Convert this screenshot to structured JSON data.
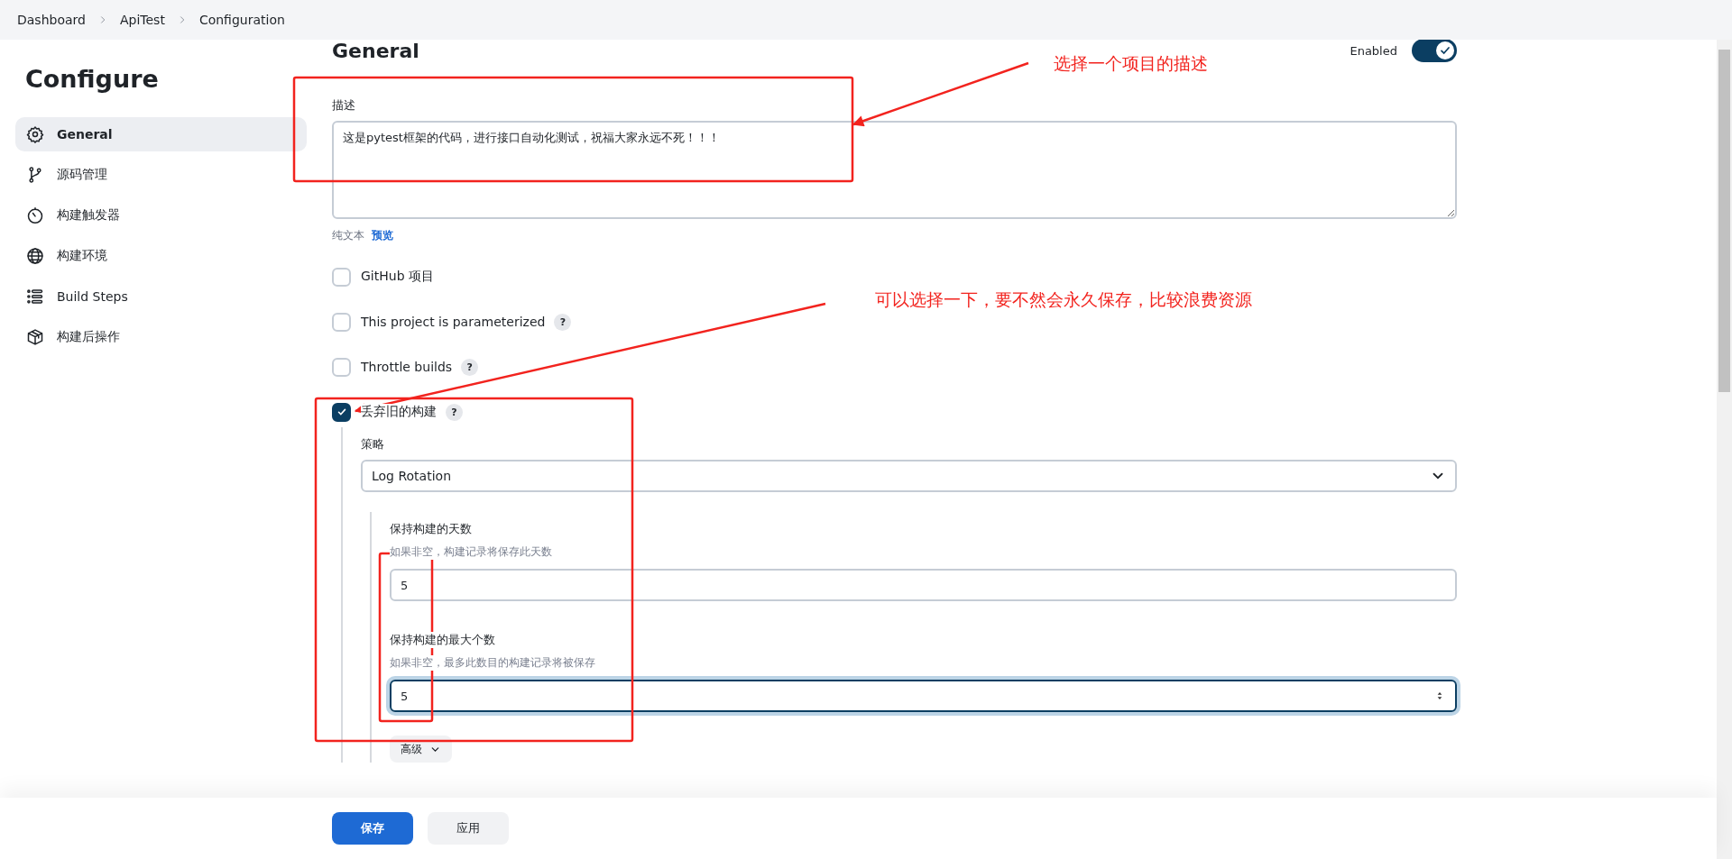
{
  "breadcrumbs": [
    "Dashboard",
    "ApiTest",
    "Configuration"
  ],
  "sidebar": {
    "title": "Configure",
    "items": [
      {
        "label": "General",
        "selected": true
      },
      {
        "label": "源码管理",
        "selected": false
      },
      {
        "label": "构建触发器",
        "selected": false
      },
      {
        "label": "构建环境",
        "selected": false
      },
      {
        "label": "Build Steps",
        "selected": false
      },
      {
        "label": "构建后操作",
        "selected": false
      }
    ]
  },
  "section": {
    "title": "General",
    "toggle": {
      "label": "Enabled",
      "on": true
    }
  },
  "description": {
    "label": "描述",
    "value": "这是pytest框架的代码，进行接口自动化测试，祝福大家永远不死！！！",
    "plain_text": "纯文本",
    "preview_link": "预览"
  },
  "options": [
    {
      "label": "GitHub 项目",
      "checked": false
    },
    {
      "label": "This project is parameterized",
      "checked": false,
      "help": "?"
    },
    {
      "label": "Throttle builds",
      "checked": false,
      "help": "?"
    },
    {
      "label": "丢弃旧的构建",
      "checked": true,
      "help": "?",
      "settings": {
        "strategy_label": "策略",
        "strategy_value": "Log Rotation",
        "fields": [
          {
            "label": "保持构建的天数",
            "hint": "如果非空，构建记录将保存此天数",
            "value": "5",
            "focused": false
          },
          {
            "label": "保持构建的最大个数",
            "hint": "如果非空，最多此数目的构建记录将被保存",
            "value": "5",
            "focused": true
          }
        ],
        "advanced_button": "高级"
      }
    }
  ],
  "footer_buttons": [
    {
      "label": "保存",
      "kind": "primary"
    },
    {
      "label": "应用",
      "kind": "secondary"
    }
  ],
  "annotations": [
    {
      "text": "选择一个项目的描述"
    },
    {
      "text": "可以选择一下，要不然会永久保存，比较浪费资源"
    }
  ]
}
